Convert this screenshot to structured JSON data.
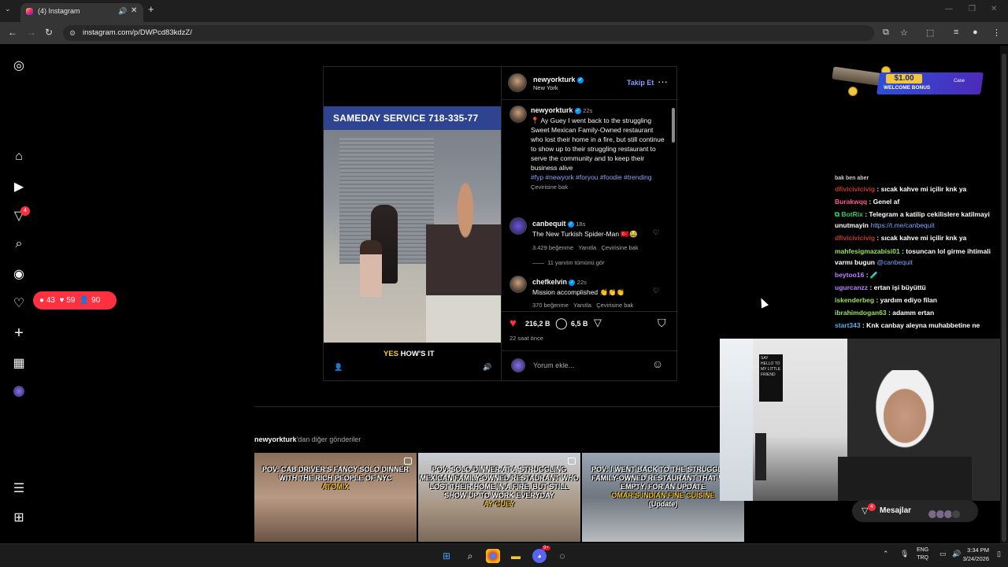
{
  "browser": {
    "tab_title": "(4) Instagram",
    "tab_mute_icon": "speaker-icon",
    "tab_close": "✕",
    "new_tab": "+",
    "url": "instagram.com/p/DWPcd83kdzZ/"
  },
  "sidebar": {
    "home_badge": "4",
    "notifications": {
      "comments": "43",
      "likes": "59",
      "follows": "90"
    }
  },
  "post": {
    "username": "newyorkturk",
    "location": "New York",
    "follow_label": "Takip Et",
    "video_caption_yellow": "YES",
    "video_caption_white": "HOW'S IT",
    "video_sign": "SAMEDAY SERVICE  718-335-77",
    "caption": {
      "username": "newyorkturk",
      "time": "22s",
      "text": "📍 Ay Guey I went back to the struggling Sweet Mexican Family-Owned restaurant who lost their home in a fire, but still continue to show up to their struggling restaurant to serve the community and to keep their business alive",
      "tags": "#fyp #newyork #foryou #foodie #trending",
      "translate": "Çevirisine bak"
    },
    "comments": [
      {
        "username": "canbequit",
        "time": "18s",
        "text": "The New Turkish Spider-Man 🇹🇷😂",
        "likes": "3.429 beğenme",
        "reply": "Yanıtla",
        "translate": "Çevirisine bak"
      },
      {
        "username": "chefkelvin",
        "time": "22s",
        "text": "Mission accomplished 👏👏👏",
        "likes": "370 beğenme",
        "reply": "Yanıtla",
        "translate": "Çevirisine bak"
      }
    ],
    "view_replies": "11 yanıtın tümünü gör",
    "like_count": "216,2 B",
    "comment_count": "6,5 B",
    "time_ago": "22 saat önce",
    "add_comment_placeholder": "Yorum ekle..."
  },
  "more_posts": {
    "username": "newyorkturk",
    "suffix": "'dan diğer gönderiler",
    "items": [
      {
        "title": "POV: CAB DRIVER'S FANCY SOLO DINNER WITH THE RICH PEOPLE OF NYC",
        "highlight": "ATOMIX",
        "sub": ""
      },
      {
        "title": "POV: SOLO DINNER AT A STRUGGLING MEXICAN FAMILY-OWNED RESTAURANT WHO LOST THEIR HOME IN A FIRE, BUT STILL SHOW UP TO WORK EVERYDAY",
        "highlight": "AY GUEY",
        "sub": ""
      },
      {
        "title": "POV: I WENT BACK TO THE STRUGGLING FAMILY-OWNED RESTAURANT THAT WAS EMPTY, FOR AN UPDATE",
        "highlight": "OMAR'S INDIAN FINE CUISINE",
        "sub": "(Update)"
      }
    ]
  },
  "bonus": {
    "amount": "$1.00",
    "label": "WELCOME BONUS",
    "brand": "Case"
  },
  "chat": [
    {
      "user": "bak ben aber",
      "text": "",
      "color": "#dddddd"
    },
    {
      "user": "dfivicivicivig",
      "text": ": sıcak kahve mi içilir knk ya",
      "color": "#c0392b"
    },
    {
      "user": "Burakwqq",
      "text": ": Genel af",
      "color": "#ff5a8a"
    },
    {
      "user": "BotRix",
      "text": ": Telegram a katilip cekilislere katilmayi unutmayin",
      "link": "https://t.me/canbequit",
      "color": "#2ecc71"
    },
    {
      "user": "dfivicivicivig",
      "text": ": sıcak kahve mi içilir knk ya",
      "color": "#c0392b"
    },
    {
      "user": "mahfesigmazabisi01",
      "text": ": tosuncan lol girme ihtimali varmı bugun",
      "mention": "@canbequit",
      "color": "#9be15d"
    },
    {
      "user": "beytoo16",
      "text": ": 🧪",
      "color": "#b983ff"
    },
    {
      "user": "ugurcanzz",
      "text": ": ertan işi büyüttü",
      "color": "#b983ff"
    },
    {
      "user": "iskenderbeg",
      "text": ": yardım ediyo filan",
      "color": "#9be15d"
    },
    {
      "user": "ibrahimdogan63",
      "text": ": adamm ertan",
      "color": "#9be15d"
    },
    {
      "user": "start343",
      "text": ": Knk canbay aleyna muhabbetine ne",
      "color": "#5dade2"
    }
  ],
  "webcam": {
    "poster_text": "SAY HELLO TO MY LITTLE FRIEND"
  },
  "messages": {
    "label": "Mesajlar",
    "badge": "4"
  },
  "taskbar": {
    "lang_top": "ENG",
    "lang_bottom": "TRQ",
    "time": "3:34 PM",
    "date": "3/24/2026",
    "discord_badge": "9+"
  }
}
